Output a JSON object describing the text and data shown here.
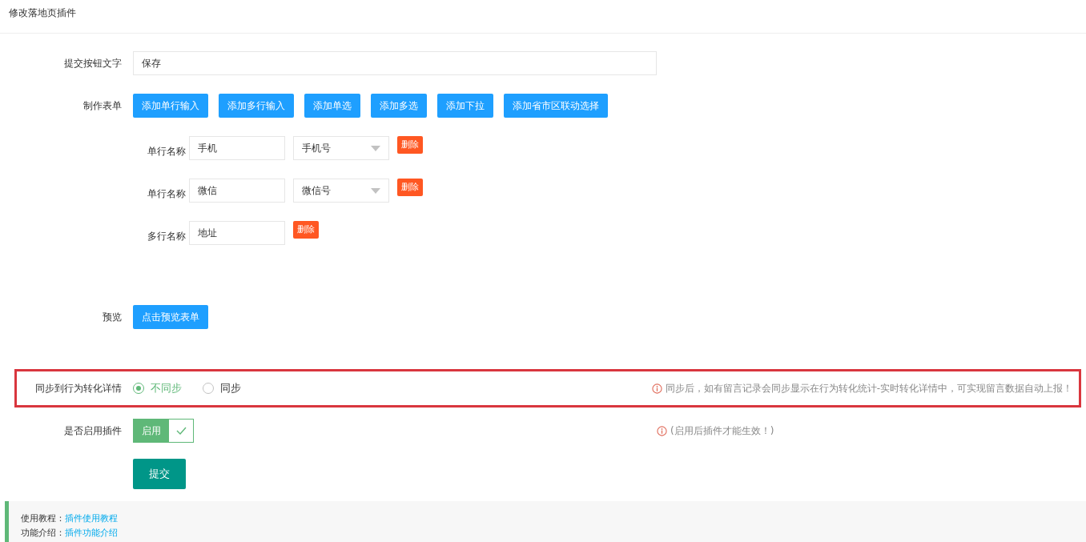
{
  "header": {
    "title": "修改落地页插件"
  },
  "submit_text": {
    "label": "提交按钮文字",
    "value": "保存"
  },
  "form_builder": {
    "label": "制作表单",
    "buttons": [
      "添加单行输入",
      "添加多行输入",
      "添加单选",
      "添加多选",
      "添加下拉",
      "添加省市区联动选择"
    ]
  },
  "fields": [
    {
      "kind": "single",
      "label": "单行名称",
      "value": "手机",
      "type": "手机号",
      "delete": "删除"
    },
    {
      "kind": "single",
      "label": "单行名称",
      "value": "微信",
      "type": "微信号",
      "delete": "删除"
    },
    {
      "kind": "multi",
      "label": "多行名称",
      "value": "地址",
      "delete": "删除"
    }
  ],
  "preview": {
    "label": "预览",
    "button": "点击预览表单"
  },
  "sync": {
    "label": "同步到行为转化详情",
    "options": [
      {
        "label": "不同步",
        "selected": true
      },
      {
        "label": "同步",
        "selected": false
      }
    ],
    "hint": "同步后，如有留言记录会同步显示在行为转化统计-实时转化详情中，可实现留言数据自动上报！"
  },
  "enable": {
    "label": "是否启用插件",
    "on": true,
    "text": "启用",
    "hint": "(启用后插件才能生效！)"
  },
  "submit_button": "提交",
  "footer": [
    {
      "label": "使用教程：",
      "link": "插件使用教程"
    },
    {
      "label": "功能介绍：",
      "link": "插件功能介绍"
    }
  ]
}
